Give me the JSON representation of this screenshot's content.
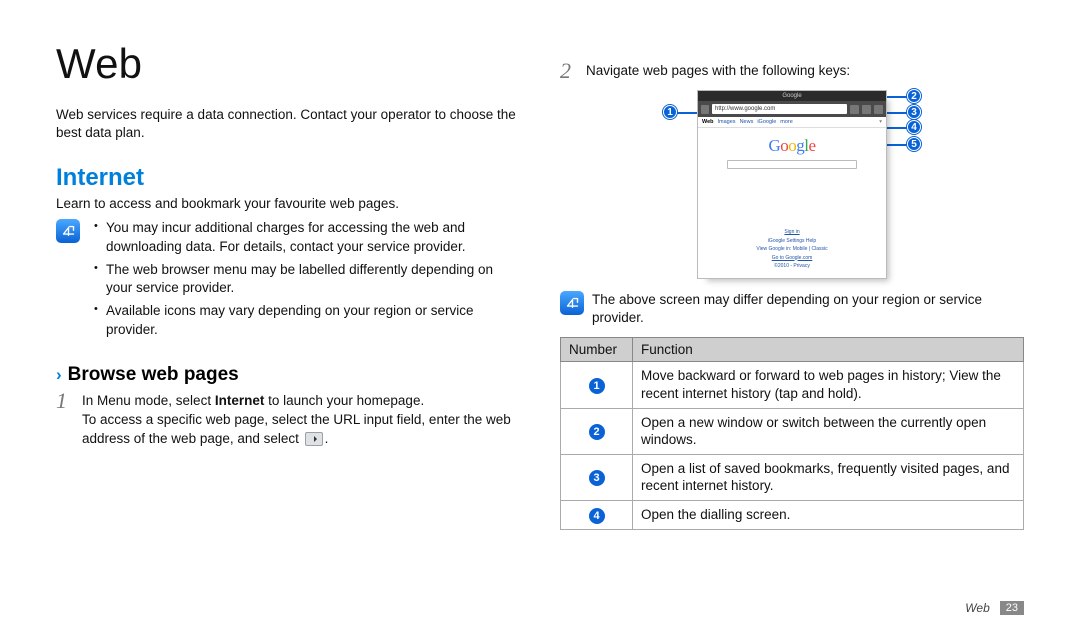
{
  "title": "Web",
  "intro": "Web services require a data connection. Contact your operator to choose the best data plan.",
  "section_internet": {
    "heading": "Internet",
    "lead": "Learn to access and bookmark your favourite web pages.",
    "notes": [
      "You may incur additional charges for accessing the web and downloading data. For details, contact your service provider.",
      "The web browser menu may be labelled differently depending on your service provider.",
      "Available icons may vary depending on your region or service provider."
    ]
  },
  "subsection_browse": {
    "heading": "Browse web pages",
    "step1_pre": "In Menu mode, select ",
    "step1_bold": "Internet",
    "step1_post": " to launch your homepage.",
    "step1_line2_pre": "To access a specific web page, select the URL input field, enter the web address of the web page, and select ",
    "step1_line2_post": "."
  },
  "right": {
    "step2": "Navigate web pages with the following keys:",
    "screenshot": {
      "top_title": "Google",
      "url": "http://www.google.com",
      "tabs": [
        "Web",
        "Images",
        "News",
        "iGoogle",
        "more"
      ],
      "logo": [
        "G",
        "o",
        "o",
        "g",
        "l",
        "e"
      ],
      "footer_links": [
        "Sign in",
        "iGoogle   Settings   Help",
        "View Google in: Mobile | Classic",
        "Go to Google.com",
        "©2010 - Privacy"
      ]
    },
    "callouts": [
      "1",
      "2",
      "3",
      "4",
      "5"
    ],
    "note": "The above screen may differ depending on your region or service provider.",
    "table": {
      "headers": {
        "num": "Number",
        "func": "Function"
      },
      "rows": [
        {
          "n": "1",
          "f": "Move backward or forward to web pages in history; View the recent internet history (tap and hold)."
        },
        {
          "n": "2",
          "f": "Open a new window or switch between the currently open windows."
        },
        {
          "n": "3",
          "f": "Open a list of saved bookmarks, frequently visited pages, and recent internet history."
        },
        {
          "n": "4",
          "f": "Open the dialling screen."
        }
      ]
    }
  },
  "footer": {
    "label": "Web",
    "page": "23"
  }
}
